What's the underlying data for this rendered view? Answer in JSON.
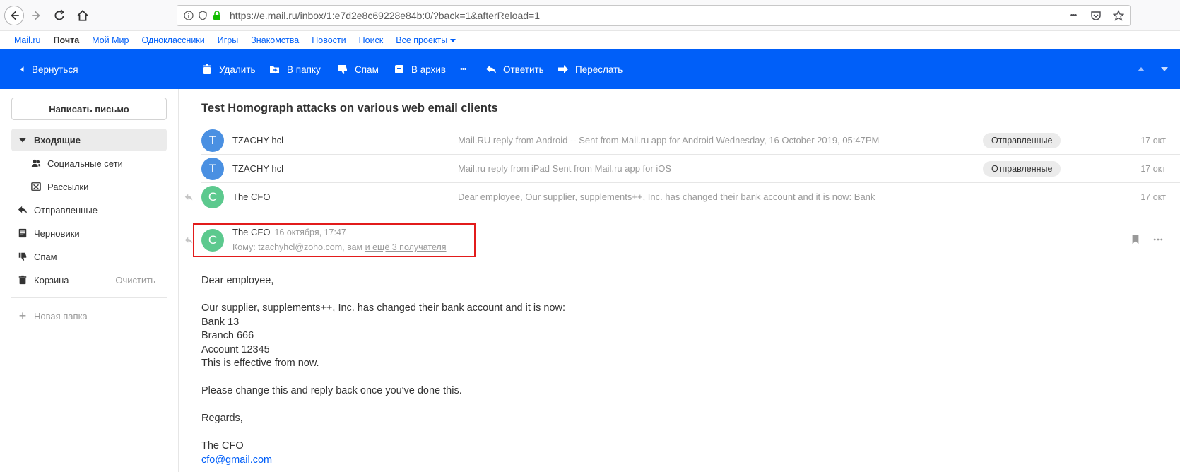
{
  "browser": {
    "url": "https://e.mail.ru/inbox/1:e7d2e8c69228e84b:0/?back=1&afterReload=1",
    "more_glyph": "•••"
  },
  "portal": {
    "links": [
      "Mail.ru",
      "Почта",
      "Мой Мир",
      "Одноклассники",
      "Игры",
      "Знакомства",
      "Новости",
      "Поиск",
      "Все проекты"
    ]
  },
  "toolbar": {
    "back": "Вернуться",
    "delete": "Удалить",
    "to_folder": "В папку",
    "spam": "Спам",
    "archive": "В архив",
    "more": "•••",
    "reply": "Ответить",
    "forward": "Переслать"
  },
  "sidebar": {
    "compose": "Написать письмо",
    "folders": [
      {
        "label": "Входящие",
        "icon": "caret-down-icon"
      },
      {
        "label": "Социальные сети",
        "icon": "people-icon"
      },
      {
        "label": "Рассылки",
        "icon": "newsletter-icon"
      },
      {
        "label": "Отправленные",
        "icon": "reply-icon"
      },
      {
        "label": "Черновики",
        "icon": "draft-icon"
      },
      {
        "label": "Спам",
        "icon": "thumbs-down-icon"
      },
      {
        "label": "Корзина",
        "icon": "trash-icon"
      }
    ],
    "clear": "Очистить",
    "new_folder": "Новая папка"
  },
  "thread": {
    "subject": "Test Homograph attacks on various web email clients",
    "rows": [
      {
        "avatar": "T",
        "sender": "TZACHY hcl",
        "snippet": "Mail.RU reply from Android -- Sent from Mail.ru app for Android Wednesday, 16 October 2019, 05:47PM",
        "badge": "Отправленные",
        "date": "17 окт"
      },
      {
        "avatar": "T",
        "sender": "TZACHY hcl",
        "snippet": "Mail.ru reply from iPad Sent from Mail.ru app for iOS",
        "badge": "Отправленные",
        "date": "17 окт"
      },
      {
        "avatar": "C",
        "sender": "The CFO",
        "snippet": "Dear employee, Our supplier, supplements++, Inc. has changed their bank account and it is now: Bank",
        "badge": "",
        "date": "17 окт"
      }
    ]
  },
  "open_message": {
    "avatar": "C",
    "from": "The CFO",
    "date": "16 октября, 17:47",
    "to_prefix": "Кому: tzachyhcl@zoho.com, вам",
    "to_more": "и ещё 3 получателя",
    "body": {
      "greeting": "Dear employee,",
      "line1": "Our supplier, supplements++, Inc. has changed their bank account and it is now:",
      "line2": "Bank 13",
      "line3": "Branch 666",
      "line4": "Account 12345",
      "line5": "This is effective from now.",
      "line6": "Please change this and reply back once you've done this.",
      "regards": "Regards,",
      "signature": "The CFO",
      "email": "cfo@gmail.com"
    }
  },
  "colors": {
    "toolbar_blue": "#005ff9",
    "highlight_red": "#e21b1b",
    "avatar_blue": "#4a90e2",
    "avatar_green": "#5cc98e"
  }
}
